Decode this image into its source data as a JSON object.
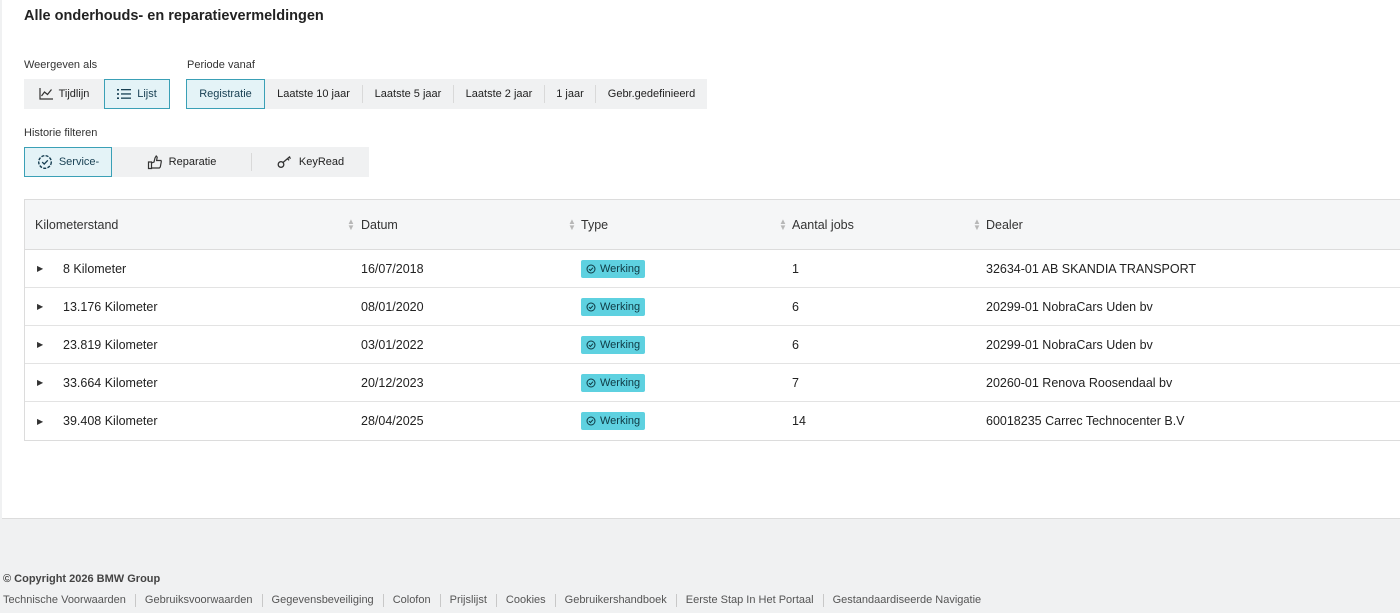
{
  "page_title": "Alle onderhouds- en reparatievermeldingen",
  "view": {
    "label": "Weergeven als",
    "options": [
      "Tijdlijn",
      "Lijst"
    ],
    "active": "Lijst"
  },
  "period": {
    "label": "Periode vanaf",
    "options": [
      "Registratie",
      "Laatste 10 jaar",
      "Laatste 5 jaar",
      "Laatste 2 jaar",
      "1 jaar",
      "Gebr.gedefinieerd"
    ],
    "active": "Registratie"
  },
  "filter": {
    "label": "Historie filteren",
    "options": [
      "Service-",
      "Reparatie",
      "KeyRead"
    ],
    "active": "Service-"
  },
  "table": {
    "columns": [
      "Kilometerstand",
      "Datum",
      "Type",
      "Aantal jobs",
      "Dealer"
    ],
    "rows": [
      {
        "km": "8 Kilometer",
        "date": "16/07/2018",
        "type": "Werking",
        "jobs": "1",
        "dealer": "32634-01 AB SKANDIA TRANSPORT"
      },
      {
        "km": "13.176 Kilometer",
        "date": "08/01/2020",
        "type": "Werking",
        "jobs": "6",
        "dealer": "20299-01 NobraCars Uden bv"
      },
      {
        "km": "23.819 Kilometer",
        "date": "03/01/2022",
        "type": "Werking",
        "jobs": "6",
        "dealer": "20299-01 NobraCars Uden bv"
      },
      {
        "km": "33.664 Kilometer",
        "date": "20/12/2023",
        "type": "Werking",
        "jobs": "7",
        "dealer": "20260-01 Renova Roosendaal bv"
      },
      {
        "km": "39.408 Kilometer",
        "date": "28/04/2025",
        "type": "Werking",
        "jobs": "14",
        "dealer": "60018235 Carrec Technocenter B.V"
      }
    ]
  },
  "footer": {
    "copyright": "© Copyright 2026 BMW Group",
    "links": [
      "Technische Voorwaarden",
      "Gebruiksvoorwaarden",
      "Gegevensbeveiliging",
      "Colofon",
      "Prijslijst",
      "Cookies",
      "Gebruikershandboek",
      "Eerste Stap In Het Portaal",
      "Gestandaardiseerde Navigatie"
    ]
  },
  "colors": {
    "accent": "#3aa0b6",
    "badge": "#5ed1e0",
    "active_bg": "#e4f3f7"
  }
}
